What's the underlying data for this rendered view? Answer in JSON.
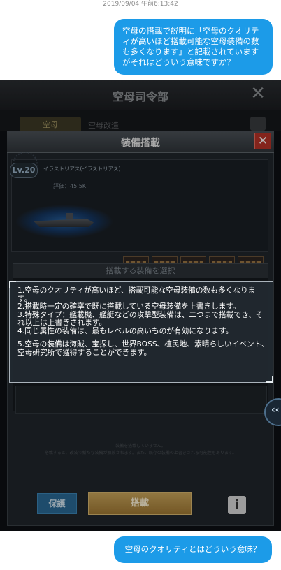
{
  "chat": {
    "timestamp": "2019/09/04 午前6:13:42",
    "question1": "空母の搭載で説明に「空母のクオリティが高いほど搭載可能な空母装備の数も多くなります」と記載されていますがそれはどういう意味ですか？",
    "question2": "空母のクオリティとはどういう意味？"
  },
  "game": {
    "header_title": "空母司令部",
    "close_glyph": "✕",
    "tab1_label": "空母",
    "tab2_label": "空母改造",
    "dialog": {
      "title": "装備搭載",
      "close_glyph": "✕",
      "level": "Lv.20",
      "ship_name": "イラストリアス(イラストリアス)",
      "rating": "評価：45.5K",
      "select_bar": "搭載する装備を選択",
      "bottom_note_1": "装備を搭載していません。",
      "bottom_note_2": "搭載すると、改装で新たな装備が解放されます。また、既存の装備の上書きされる可能性もあります。",
      "protect_button": "保護",
      "equip_button": "搭載",
      "info_button": "i"
    },
    "tooltip": {
      "line1": "1.空母のクオリティが高いほど、搭載可能な空母装備の数も多くなります。",
      "line2": "2.搭載時一定の確率で既に搭載している空母装備を上書きします。",
      "line3": "3.特殊タイプ：艦載機、艦艇などの攻撃型装備は、二つまで搭載でき、それ以上は上書きされます。",
      "line4": "4.同じ属性の装備は、最もレベルの高いものが有効になります。",
      "line5": "5.空母の装備は海賊、宝探し、世界BOSS、植民地、素晴らしいイベント、空母研究所で獲得することができます。"
    },
    "edge_button_glyph": "‹‹"
  }
}
